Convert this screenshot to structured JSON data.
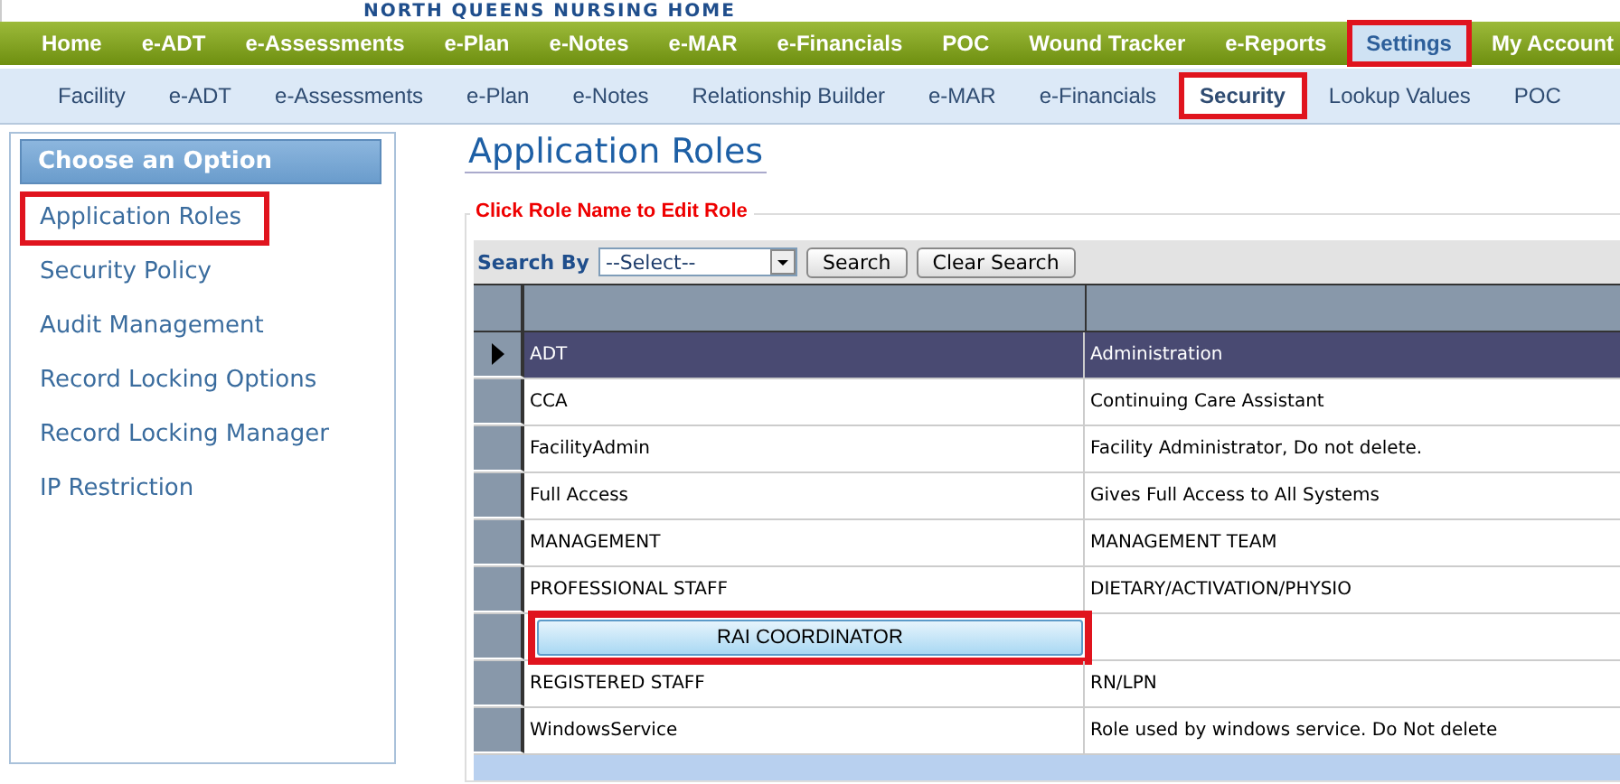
{
  "header": {
    "title": "NORTH QUEENS NURSING HOME"
  },
  "main_nav": [
    {
      "label": "Home",
      "selected": false,
      "highlighted": false
    },
    {
      "label": "e-ADT",
      "selected": false,
      "highlighted": false
    },
    {
      "label": "e-Assessments",
      "selected": false,
      "highlighted": false
    },
    {
      "label": "e-Plan",
      "selected": false,
      "highlighted": false
    },
    {
      "label": "e-Notes",
      "selected": false,
      "highlighted": false
    },
    {
      "label": "e-MAR",
      "selected": false,
      "highlighted": false
    },
    {
      "label": "e-Financials",
      "selected": false,
      "highlighted": false
    },
    {
      "label": "POC",
      "selected": false,
      "highlighted": false
    },
    {
      "label": "Wound Tracker",
      "selected": false,
      "highlighted": false
    },
    {
      "label": "e-Reports",
      "selected": false,
      "highlighted": false
    },
    {
      "label": "Settings",
      "selected": true,
      "highlighted": true
    },
    {
      "label": "My Account",
      "selected": false,
      "highlighted": false
    }
  ],
  "sub_nav": [
    {
      "label": "Facility",
      "selected": false,
      "highlighted": false
    },
    {
      "label": "e-ADT",
      "selected": false,
      "highlighted": false
    },
    {
      "label": "e-Assessments",
      "selected": false,
      "highlighted": false
    },
    {
      "label": "e-Plan",
      "selected": false,
      "highlighted": false
    },
    {
      "label": "e-Notes",
      "selected": false,
      "highlighted": false
    },
    {
      "label": "Relationship Builder",
      "selected": false,
      "highlighted": false
    },
    {
      "label": "e-MAR",
      "selected": false,
      "highlighted": false
    },
    {
      "label": "e-Financials",
      "selected": false,
      "highlighted": false
    },
    {
      "label": "Security",
      "selected": true,
      "highlighted": true
    },
    {
      "label": "Lookup Values",
      "selected": false,
      "highlighted": false
    },
    {
      "label": "POC",
      "selected": false,
      "highlighted": false
    }
  ],
  "sidebar": {
    "title": "Choose an Option",
    "items": [
      {
        "label": "Application Roles",
        "highlighted": true
      },
      {
        "label": "Security Policy",
        "highlighted": false
      },
      {
        "label": "Audit Management",
        "highlighted": false
      },
      {
        "label": "Record Locking Options",
        "highlighted": false
      },
      {
        "label": "Record Locking Manager",
        "highlighted": false
      },
      {
        "label": "IP Restriction",
        "highlighted": false
      }
    ]
  },
  "page_title": "Application Roles",
  "legend": "Click Role Name to Edit Role",
  "search": {
    "label": "Search By",
    "value": "--Select--",
    "buttons": [
      "Search",
      "Clear Search"
    ]
  },
  "rows": [
    {
      "name": "ADT",
      "description": "Administration",
      "current": true,
      "editing": false
    },
    {
      "name": "CCA",
      "description": "Continuing Care Assistant",
      "current": false,
      "editing": false
    },
    {
      "name": "FacilityAdmin",
      "description": "Facility Administrator, Do not delete.",
      "current": false,
      "editing": false
    },
    {
      "name": "Full Access",
      "description": "Gives Full Access to All Systems",
      "current": false,
      "editing": false
    },
    {
      "name": "MANAGEMENT",
      "description": "MANAGEMENT TEAM",
      "current": false,
      "editing": false
    },
    {
      "name": "PROFESSIONAL STAFF",
      "description": "DIETARY/ACTIVATION/PHYSIO",
      "current": false,
      "editing": false
    },
    {
      "name": "RAI COORDINATOR",
      "current": false,
      "editing": true
    },
    {
      "name": "REGISTERED STAFF",
      "description": "RN/LPN",
      "current": false,
      "editing": false
    },
    {
      "name": "WindowsService",
      "description": "Role used by windows service. Do Not delete",
      "current": false,
      "editing": false
    }
  ]
}
